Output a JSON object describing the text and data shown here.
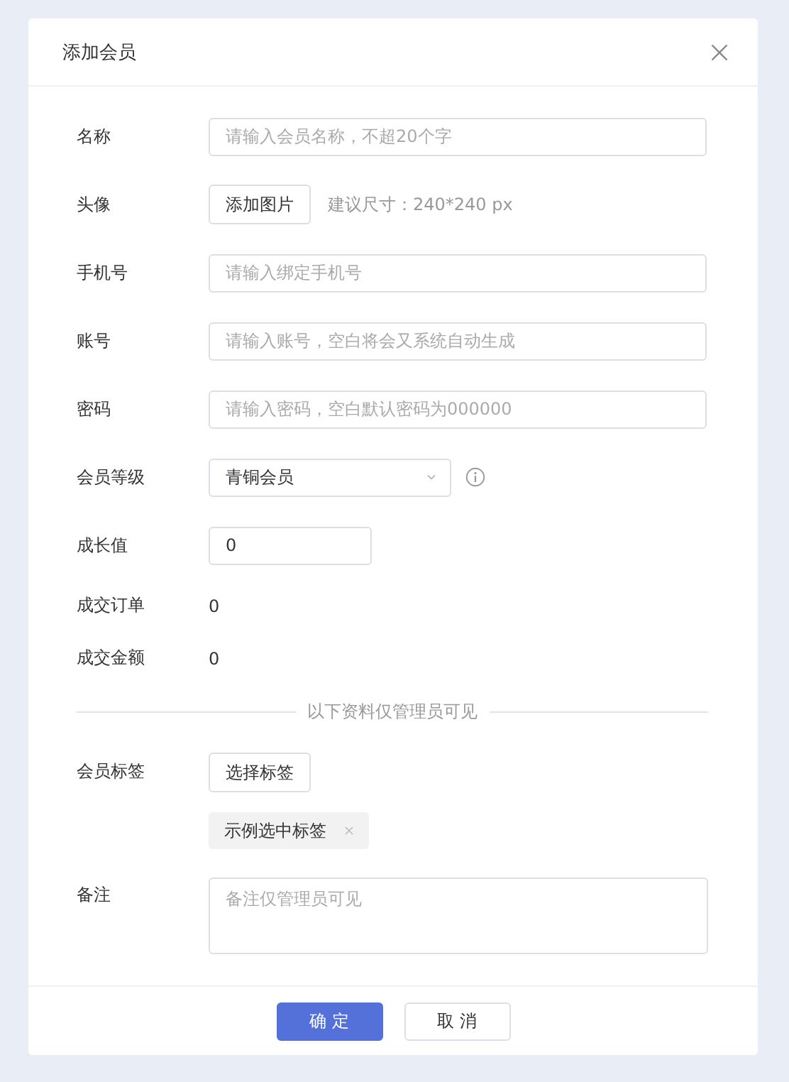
{
  "dialog": {
    "title": "添加会员",
    "fields": [
      {
        "kind": "input",
        "label": "名称",
        "placeholder": "请输入会员名称，不超20个字"
      },
      {
        "kind": "upload",
        "label": "头像",
        "button": "添加图片",
        "hint": "建议尺寸：240*240 px"
      },
      {
        "kind": "input",
        "label": "手机号",
        "placeholder": "请输入绑定手机号"
      },
      {
        "kind": "input",
        "label": "账号",
        "placeholder": "请输入账号，空白将会又系统自动生成"
      },
      {
        "kind": "input",
        "label": "密码",
        "placeholder": "请输入密码，空白默认密码为000000"
      },
      {
        "kind": "select",
        "label": "会员等级",
        "value": "青铜会员"
      },
      {
        "kind": "number",
        "label": "成长值",
        "value": "0"
      },
      {
        "kind": "text",
        "label": "成交订单",
        "value": "0"
      },
      {
        "kind": "text",
        "label": "成交金额",
        "value": "0"
      },
      {
        "kind": "divider",
        "label": "以下资料仅管理员可见"
      },
      {
        "kind": "tags",
        "label": "会员标签",
        "button": "选择标签",
        "tags": [
          "示例选中标签"
        ]
      },
      {
        "kind": "textarea",
        "label": "备注",
        "placeholder": "备注仅管理员可见"
      }
    ],
    "buttons": [
      {
        "kind": "primary",
        "label": "确 定"
      },
      {
        "kind": "default",
        "label": "取 消"
      }
    ]
  }
}
